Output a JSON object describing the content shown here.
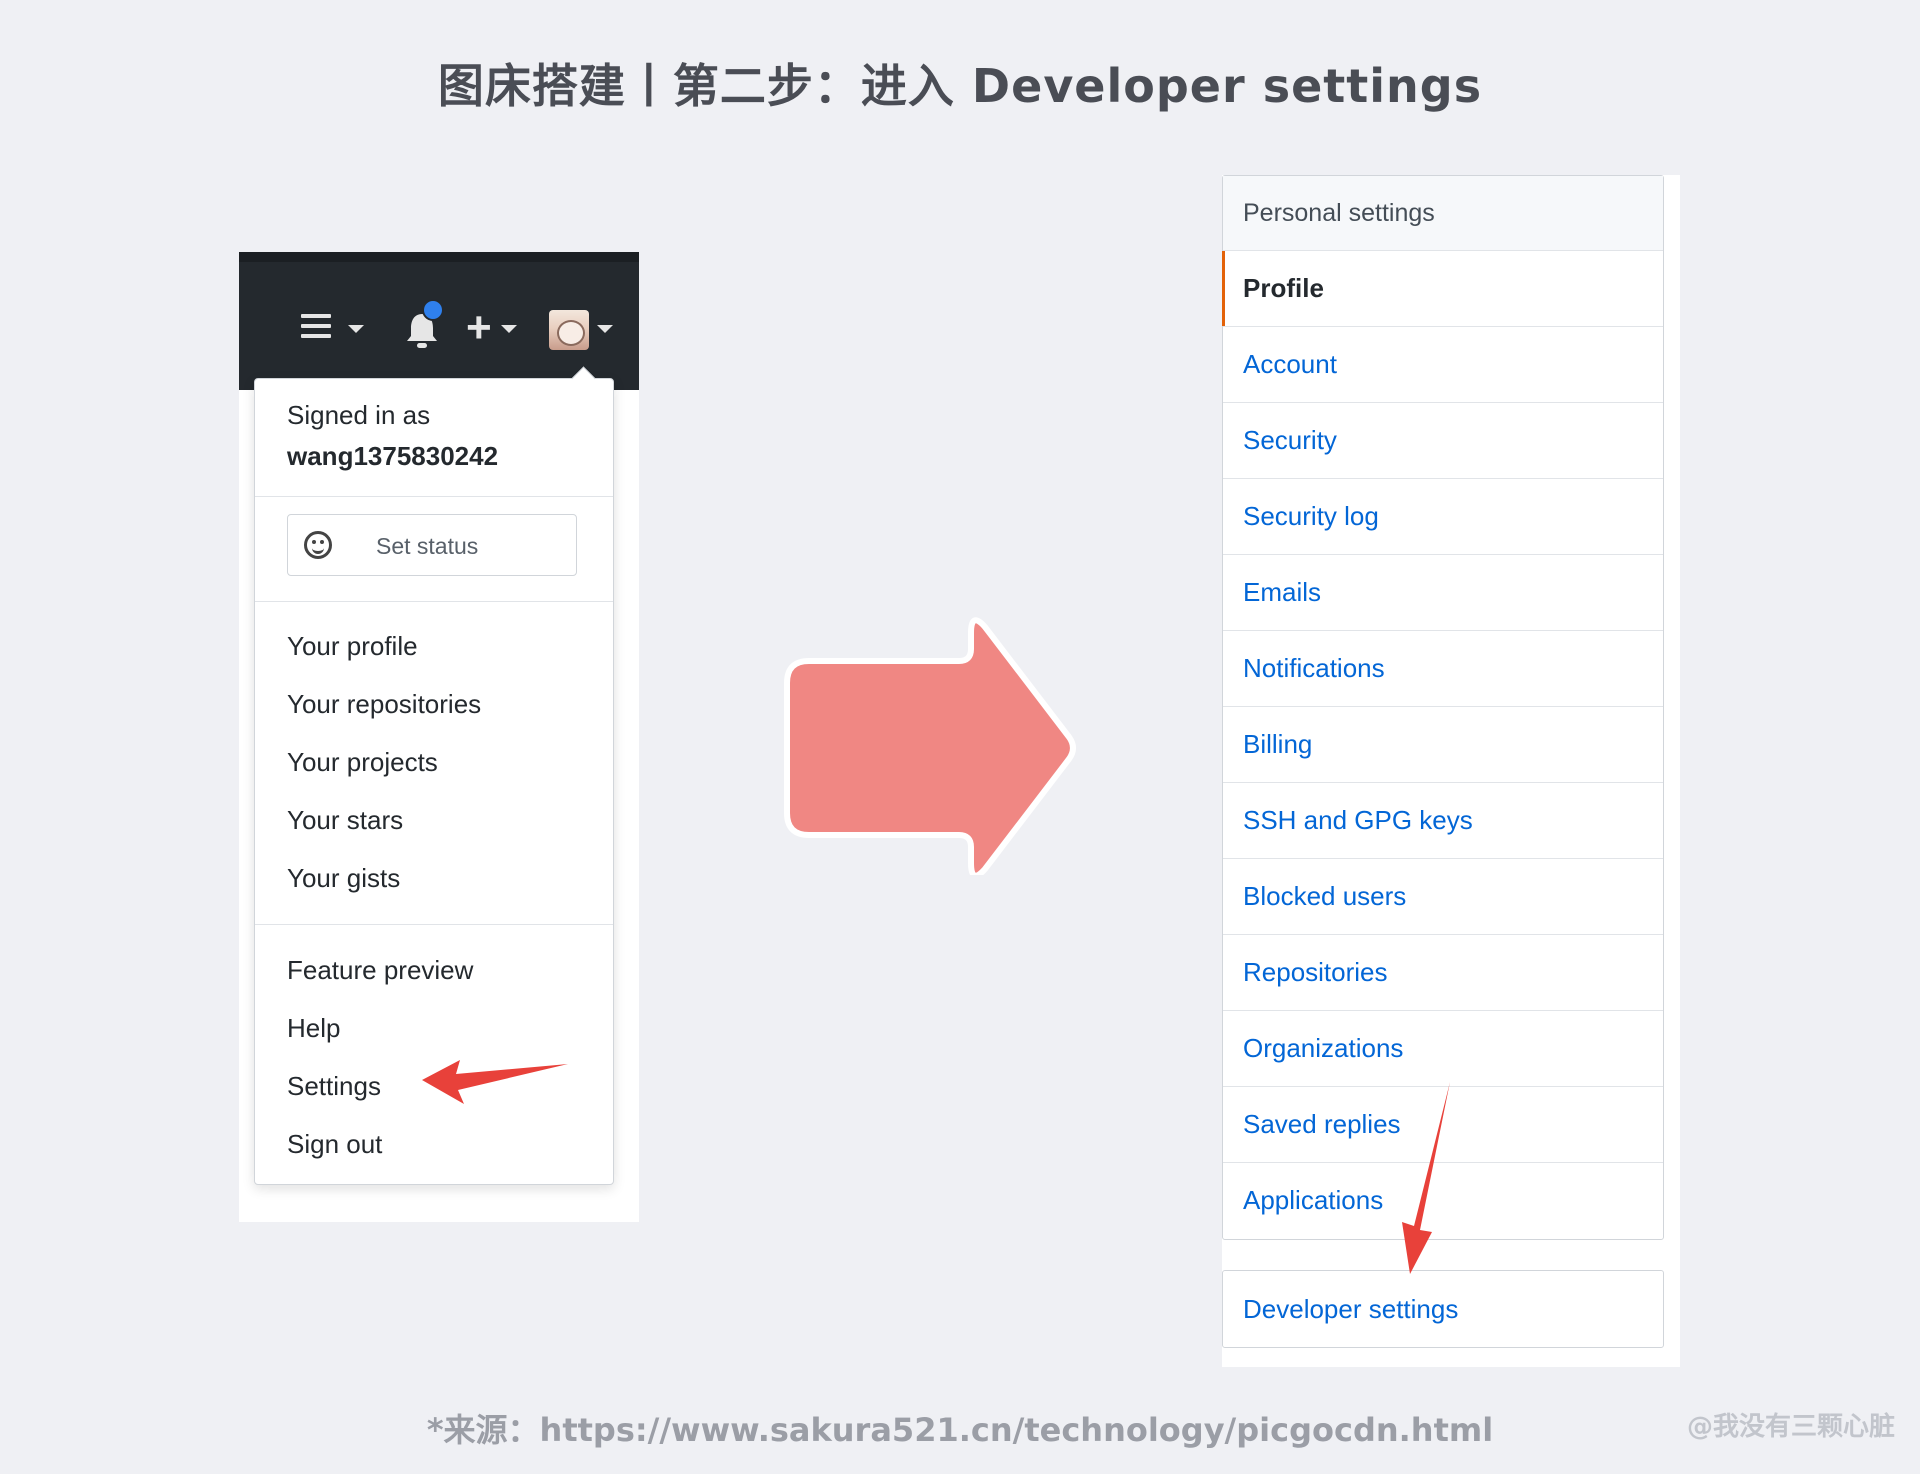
{
  "title": "图床搭建丨第二步：进入 Developer settings",
  "dropdown": {
    "signed_in_as": "Signed in as",
    "username": "wang1375830242",
    "set_status": "Set status",
    "group1": [
      "Your profile",
      "Your repositories",
      "Your projects",
      "Your stars",
      "Your gists"
    ],
    "group2": [
      "Feature preview",
      "Help",
      "Settings",
      "Sign out"
    ]
  },
  "settings_menu": {
    "header": "Personal settings",
    "items": [
      "Profile",
      "Account",
      "Security",
      "Security log",
      "Emails",
      "Notifications",
      "Billing",
      "SSH and GPG keys",
      "Blocked users",
      "Repositories",
      "Organizations",
      "Saved replies",
      "Applications"
    ],
    "selected": "Profile",
    "developer_settings": "Developer settings"
  },
  "source": "*来源：https://www.sakura521.cn/technology/picgocdn.html",
  "watermark": "@我没有三颗心脏",
  "colors": {
    "background": "#eff0f4",
    "topbar": "#24292e",
    "link": "#0366d6",
    "selected_marker": "#e36209",
    "big_arrow": "#f08783",
    "red_pointer": "#e8413a",
    "notification_dot": "#2f80ed"
  },
  "icons": {
    "menu": "hamburger-icon",
    "notifications": "bell-icon",
    "create": "plus-icon",
    "status": "smiley-icon",
    "flow": "right-arrow-icon",
    "pointer": "red-pointer-arrow-icon"
  }
}
